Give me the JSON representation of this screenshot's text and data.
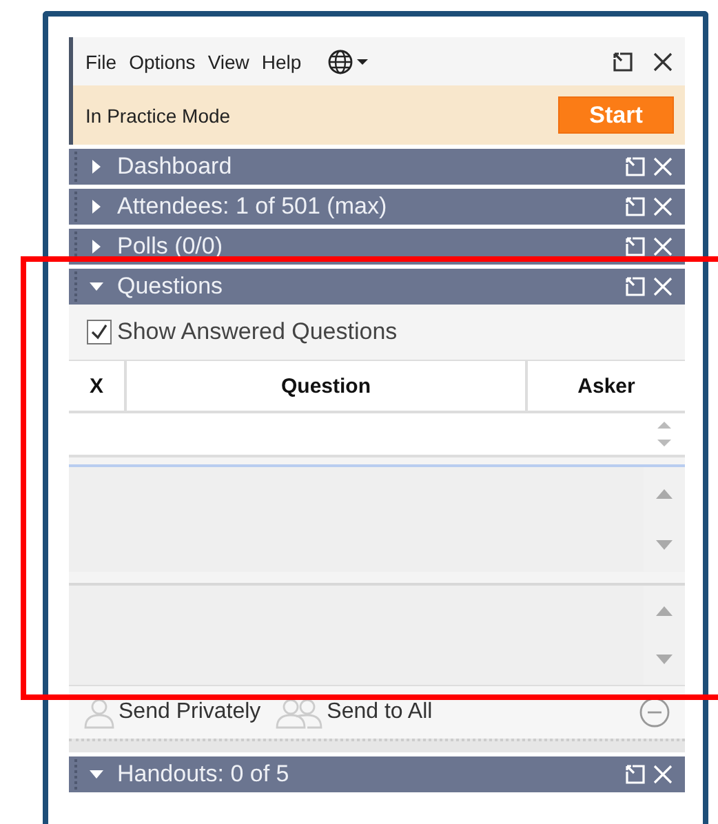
{
  "menu": [
    "File",
    "Options",
    "View",
    "Help"
  ],
  "mode_bar": {
    "text": "In Practice Mode",
    "button": "Start"
  },
  "panels": [
    {
      "title": "Dashboard",
      "expanded": false
    },
    {
      "title": "Attendees: 1 of 501 (max)",
      "expanded": false
    },
    {
      "title": "Polls (0/0)",
      "expanded": false
    },
    {
      "title": "Questions",
      "expanded": true
    }
  ],
  "questions": {
    "show_answered": {
      "label": "Show Answered Questions",
      "checked": true
    },
    "columns": [
      "X",
      "Question",
      "Asker"
    ],
    "actions": [
      "Send Privately",
      "Send to All"
    ]
  },
  "handouts": {
    "title": "Handouts: 0 of 5",
    "expanded": true
  }
}
